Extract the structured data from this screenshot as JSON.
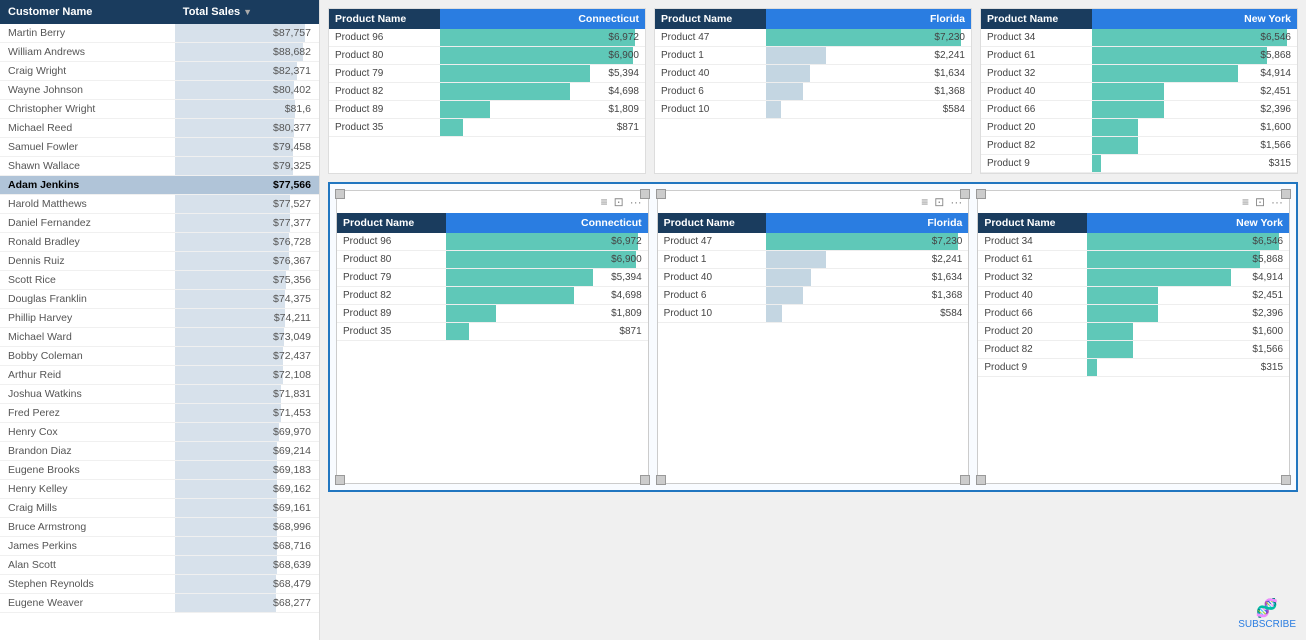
{
  "leftPanel": {
    "title": "Customer Name",
    "col2": "Total Sales",
    "customers": [
      {
        "name": "Martin Berry",
        "sales": "$87,757",
        "pct": 100
      },
      {
        "name": "William Andrews",
        "sales": "$88,682",
        "pct": 99
      },
      {
        "name": "Craig Wright",
        "sales": "$82,371",
        "pct": 94
      },
      {
        "name": "Wayne Johnson",
        "sales": "$80,402",
        "pct": 92
      },
      {
        "name": "Christopher Wright",
        "sales": "$81,6",
        "pct": 93
      },
      {
        "name": "Michael Reed",
        "sales": "$80,377",
        "pct": 92
      },
      {
        "name": "Samuel Fowler",
        "sales": "$79,458",
        "pct": 91
      },
      {
        "name": "Shawn Wallace",
        "sales": "$79,325",
        "pct": 91
      },
      {
        "name": "Adam Jenkins",
        "sales": "$77,566",
        "pct": 89,
        "highlighted": true
      },
      {
        "name": "Harold Matthews",
        "sales": "$77,527",
        "pct": 89
      },
      {
        "name": "Daniel Fernandez",
        "sales": "$77,377",
        "pct": 89
      },
      {
        "name": "Ronald Bradley",
        "sales": "$76,728",
        "pct": 88
      },
      {
        "name": "Dennis Ruiz",
        "sales": "$76,367",
        "pct": 88
      },
      {
        "name": "Scott Rice",
        "sales": "$75,356",
        "pct": 86
      },
      {
        "name": "Douglas Franklin",
        "sales": "$74,375",
        "pct": 85
      },
      {
        "name": "Phillip Harvey",
        "sales": "$74,211",
        "pct": 85
      },
      {
        "name": "Michael Ward",
        "sales": "$73,049",
        "pct": 84
      },
      {
        "name": "Bobby Coleman",
        "sales": "$72,437",
        "pct": 83
      },
      {
        "name": "Arthur Reid",
        "sales": "$72,108",
        "pct": 83
      },
      {
        "name": "Joshua Watkins",
        "sales": "$71,831",
        "pct": 82
      },
      {
        "name": "Fred Perez",
        "sales": "$71,453",
        "pct": 82
      },
      {
        "name": "Henry Cox",
        "sales": "$69,970",
        "pct": 80
      },
      {
        "name": "Brandon Diaz",
        "sales": "$69,214",
        "pct": 79
      },
      {
        "name": "Eugene Brooks",
        "sales": "$69,183",
        "pct": 79
      },
      {
        "name": "Henry Kelley",
        "sales": "$69,162",
        "pct": 79
      },
      {
        "name": "Craig Mills",
        "sales": "$69,161",
        "pct": 79
      },
      {
        "name": "Bruce Armstrong",
        "sales": "$68,996",
        "pct": 79
      },
      {
        "name": "James Perkins",
        "sales": "$68,716",
        "pct": 79
      },
      {
        "name": "Alan Scott",
        "sales": "$68,639",
        "pct": 79
      },
      {
        "name": "Stephen Reynolds",
        "sales": "$68,479",
        "pct": 78
      },
      {
        "name": "Eugene Weaver",
        "sales": "$68,277",
        "pct": 78
      }
    ]
  },
  "topCharts": [
    {
      "id": "connecticut-top",
      "col1": "Product Name",
      "col2": "Connecticut",
      "products": [
        {
          "name": "Product 96",
          "value": "$6,972",
          "pct": 100,
          "type": "teal"
        },
        {
          "name": "Product 80",
          "value": "$6,900",
          "pct": 99,
          "type": "teal"
        },
        {
          "name": "Product 79",
          "value": "$5,394",
          "pct": 77,
          "type": "teal"
        },
        {
          "name": "Product 82",
          "value": "$4,698",
          "pct": 67,
          "type": "teal"
        },
        {
          "name": "Product 89",
          "value": "$1,809",
          "pct": 26,
          "type": "teal"
        },
        {
          "name": "Product 35",
          "value": "$871",
          "pct": 12,
          "type": "teal"
        }
      ]
    },
    {
      "id": "florida-top",
      "col1": "Product Name",
      "col2": "Florida",
      "products": [
        {
          "name": "Product 47",
          "value": "$7,230",
          "pct": 100,
          "type": "teal"
        },
        {
          "name": "Product 1",
          "value": "$2,241",
          "pct": 31,
          "type": "gray"
        },
        {
          "name": "Product 40",
          "value": "$1,634",
          "pct": 23,
          "type": "gray"
        },
        {
          "name": "Product 6",
          "value": "$1,368",
          "pct": 19,
          "type": "gray"
        },
        {
          "name": "Product 10",
          "value": "$584",
          "pct": 8,
          "type": "gray"
        }
      ]
    },
    {
      "id": "newyork-top",
      "col1": "Product Name",
      "col2": "New York",
      "products": [
        {
          "name": "Product 34",
          "value": "$6,546",
          "pct": 100,
          "type": "teal"
        },
        {
          "name": "Product 61",
          "value": "$5,868",
          "pct": 90,
          "type": "teal"
        },
        {
          "name": "Product 32",
          "value": "$4,914",
          "pct": 75,
          "type": "teal"
        },
        {
          "name": "Product 40",
          "value": "$2,451",
          "pct": 37,
          "type": "teal"
        },
        {
          "name": "Product 66",
          "value": "$2,396",
          "pct": 37,
          "type": "teal"
        },
        {
          "name": "Product 20",
          "value": "$1,600",
          "pct": 24,
          "type": "teal"
        },
        {
          "name": "Product 82",
          "value": "$1,566",
          "pct": 24,
          "type": "teal"
        },
        {
          "name": "Product 9",
          "value": "$315",
          "pct": 5,
          "type": "teal"
        }
      ]
    }
  ],
  "bottomCharts": [
    {
      "id": "connecticut-bot",
      "col1": "Product Name",
      "col2": "Connecticut",
      "products": [
        {
          "name": "Product 96",
          "value": "$6,972",
          "pct": 100,
          "type": "teal"
        },
        {
          "name": "Product 80",
          "value": "$6,900",
          "pct": 99,
          "type": "teal"
        },
        {
          "name": "Product 79",
          "value": "$5,394",
          "pct": 77,
          "type": "teal"
        },
        {
          "name": "Product 82",
          "value": "$4,698",
          "pct": 67,
          "type": "teal"
        },
        {
          "name": "Product 89",
          "value": "$1,809",
          "pct": 26,
          "type": "teal"
        },
        {
          "name": "Product 35",
          "value": "$871",
          "pct": 12,
          "type": "teal"
        }
      ]
    },
    {
      "id": "florida-bot",
      "col1": "Product Name",
      "col2": "Florida",
      "products": [
        {
          "name": "Product 47",
          "value": "$7,230",
          "pct": 100,
          "type": "teal"
        },
        {
          "name": "Product 1",
          "value": "$2,241",
          "pct": 31,
          "type": "gray"
        },
        {
          "name": "Product 40",
          "value": "$1,634",
          "pct": 23,
          "type": "gray"
        },
        {
          "name": "Product 6",
          "value": "$1,368",
          "pct": 19,
          "type": "gray"
        },
        {
          "name": "Product 10",
          "value": "$584",
          "pct": 8,
          "type": "gray"
        }
      ]
    },
    {
      "id": "newyork-bot",
      "col1": "Product Name",
      "col2": "New York",
      "products": [
        {
          "name": "Product 34",
          "value": "$6,546",
          "pct": 100,
          "type": "teal"
        },
        {
          "name": "Product 61",
          "value": "$5,868",
          "pct": 90,
          "type": "teal"
        },
        {
          "name": "Product 32",
          "value": "$4,914",
          "pct": 75,
          "type": "teal"
        },
        {
          "name": "Product 40",
          "value": "$2,451",
          "pct": 37,
          "type": "teal"
        },
        {
          "name": "Product 66",
          "value": "$2,396",
          "pct": 37,
          "type": "teal"
        },
        {
          "name": "Product 20",
          "value": "$1,600",
          "pct": 24,
          "type": "teal"
        },
        {
          "name": "Product 82",
          "value": "$1,566",
          "pct": 24,
          "type": "teal"
        },
        {
          "name": "Product 9",
          "value": "$315",
          "pct": 5,
          "type": "teal"
        }
      ]
    }
  ],
  "subscribe": {
    "label": "SUBSCRIBE",
    "icon": "dna"
  },
  "toolbar": {
    "ellipsis": "···",
    "resize_icon": "⊡",
    "lines_icon": "≡"
  }
}
